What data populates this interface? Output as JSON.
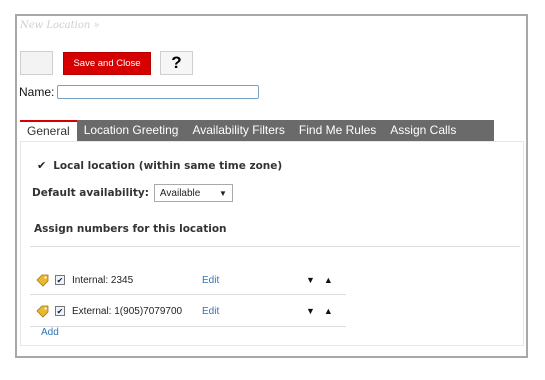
{
  "breadcrumb": "New Location »",
  "toolbar": {
    "save_close_label": "Save and Close",
    "help_label": "?"
  },
  "name_field": {
    "label": "Name:",
    "value": ""
  },
  "tabs": [
    {
      "label": "General",
      "active": true
    },
    {
      "label": "Location Greeting",
      "active": false
    },
    {
      "label": "Availability Filters",
      "active": false
    },
    {
      "label": "Find Me Rules",
      "active": false
    },
    {
      "label": "Assign Calls",
      "active": false
    }
  ],
  "general": {
    "local_location_label": "Local location (within same time zone)",
    "local_location_checked": true,
    "default_availability_label": "Default availability:",
    "default_availability_value": "Available",
    "assign_header": "Assign numbers for this location",
    "numbers": [
      {
        "label": "Internal:",
        "value": "2345",
        "edit": "Edit",
        "checked": true
      },
      {
        "label": "External:",
        "value": "1(905)7079700",
        "edit": "Edit",
        "checked": true
      }
    ],
    "add_label": "Add"
  },
  "colors": {
    "accent_red": "#d60000",
    "tab_bar": "#6a6a6a",
    "link_blue": "#2e74b5"
  }
}
